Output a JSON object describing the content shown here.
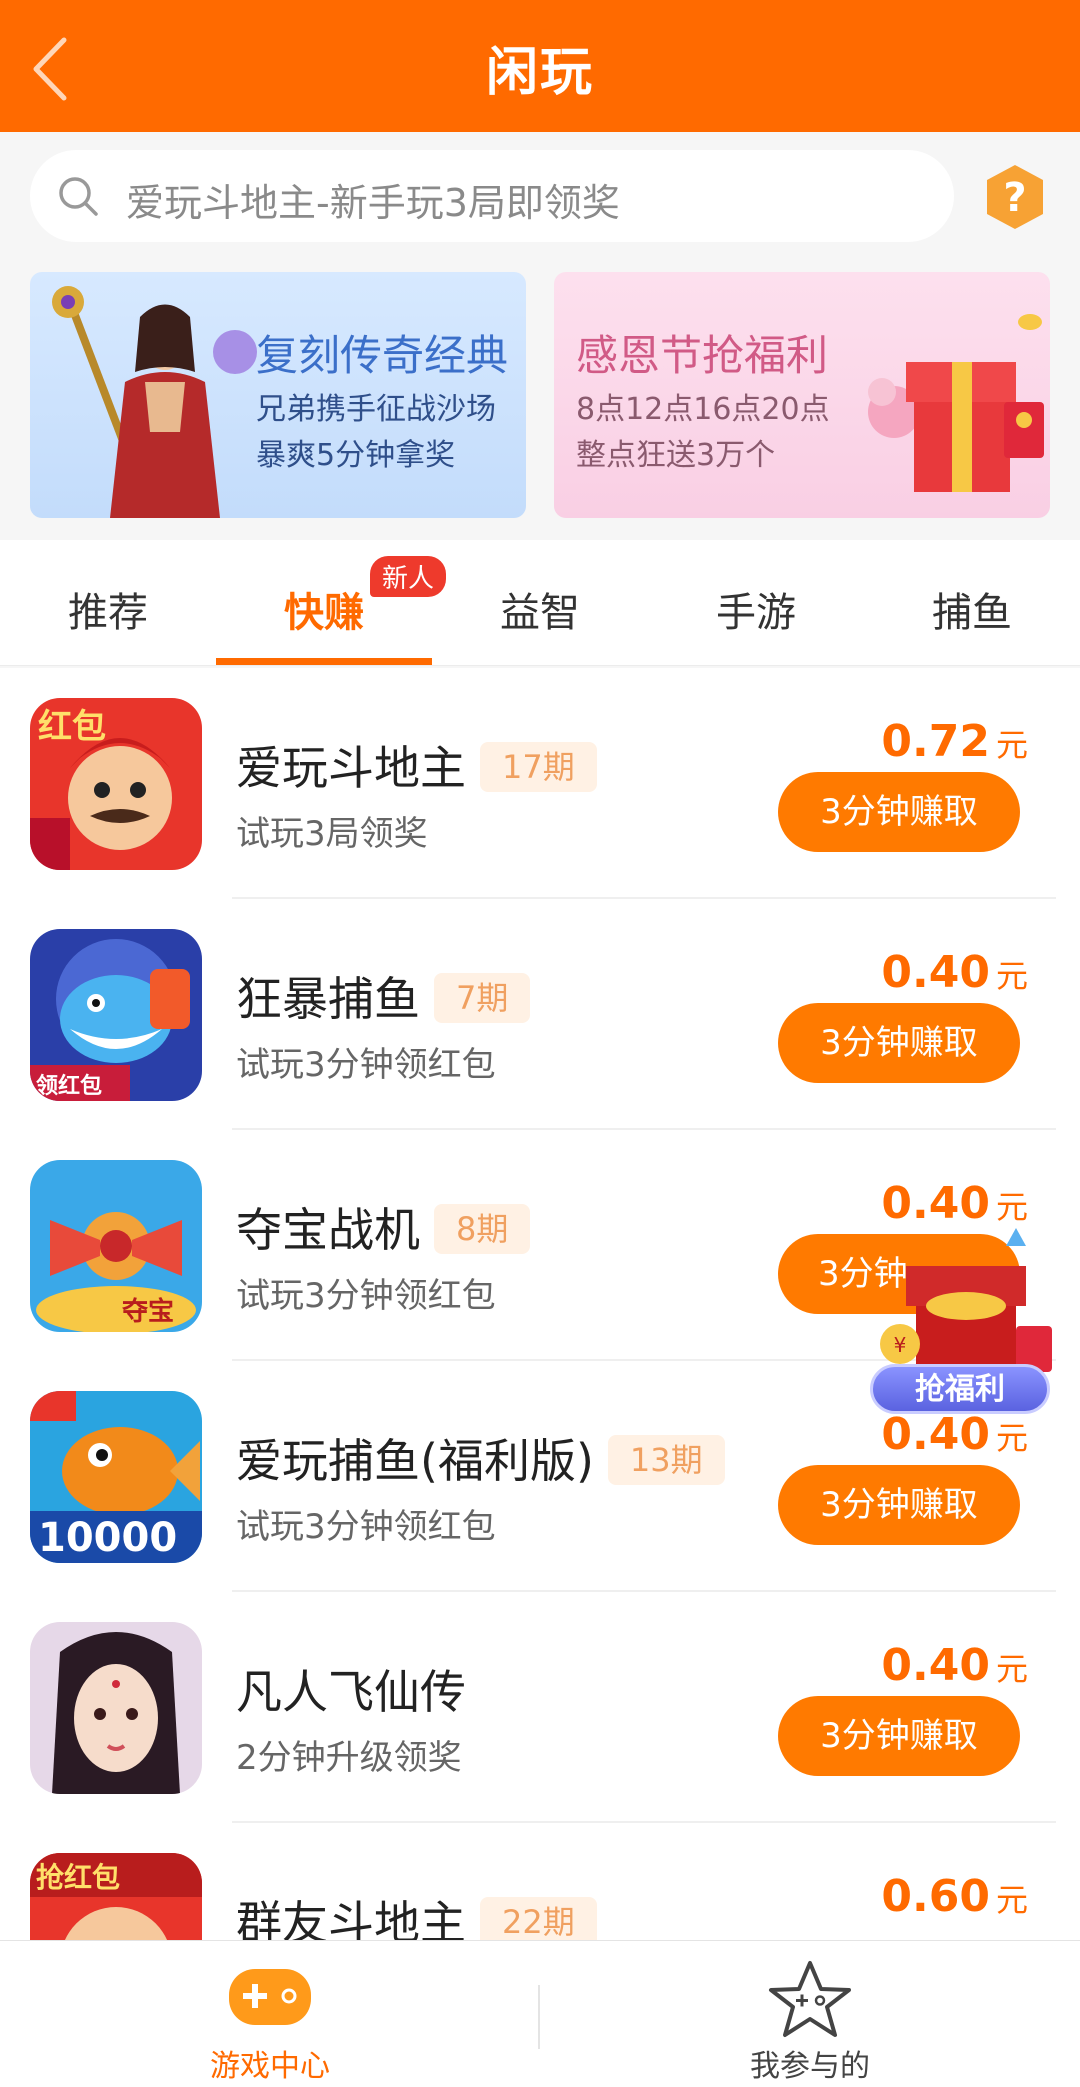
{
  "header": {
    "title": "闲玩"
  },
  "search": {
    "placeholder": "爱玩斗地主-新手玩3局即领奖"
  },
  "banners": [
    {
      "title": "复刻传奇经典",
      "line1": "兄弟携手征战沙场",
      "line2": "暴爽5分钟拿奖"
    },
    {
      "title": "感恩节抢福利",
      "line1": "8点12点16点20点",
      "line2": "整点狂送3万个"
    }
  ],
  "tabs": [
    {
      "label": "推荐"
    },
    {
      "label": "快赚",
      "badge": "新人"
    },
    {
      "label": "益智"
    },
    {
      "label": "手游"
    },
    {
      "label": "捕鱼"
    }
  ],
  "games": [
    {
      "name": "爱玩斗地主",
      "issue": "17期",
      "desc": "试玩3局领奖",
      "price": "0.72",
      "unit": "元",
      "button": "3分钟赚取",
      "icon_text": "红包"
    },
    {
      "name": "狂暴捕鱼",
      "issue": "7期",
      "desc": "试玩3分钟领红包",
      "price": "0.40",
      "unit": "元",
      "button": "3分钟赚取",
      "icon_text": "领红包"
    },
    {
      "name": "夺宝战机",
      "issue": "8期",
      "desc": "试玩3分钟领红包",
      "price": "0.40",
      "unit": "元",
      "button": "3分钟",
      "icon_text": "夺宝"
    },
    {
      "name": "爱玩捕鱼(福利版)",
      "issue": "13期",
      "desc": "试玩3分钟领红包",
      "price": "0.40",
      "unit": "元",
      "button": "3分钟赚取",
      "icon_text": "10000"
    },
    {
      "name": "凡人飞仙传",
      "issue": "",
      "desc": "2分钟升级领奖",
      "price": "0.40",
      "unit": "元",
      "button": "3分钟赚取",
      "icon_text": ""
    },
    {
      "name": "群友斗地主",
      "issue": "22期",
      "desc": "",
      "price": "0.60",
      "unit": "元",
      "button": "",
      "icon_text": "抢红包"
    }
  ],
  "float_widget": {
    "label": "抢福利"
  },
  "bottom_nav": [
    {
      "label": "游戏中心",
      "icon": "gamepad-icon"
    },
    {
      "label": "我参与的",
      "icon": "star-icon"
    }
  ],
  "colors": {
    "accent": "#ff6a00",
    "button": "#ff7a00",
    "issue_text": "#f0a060"
  }
}
